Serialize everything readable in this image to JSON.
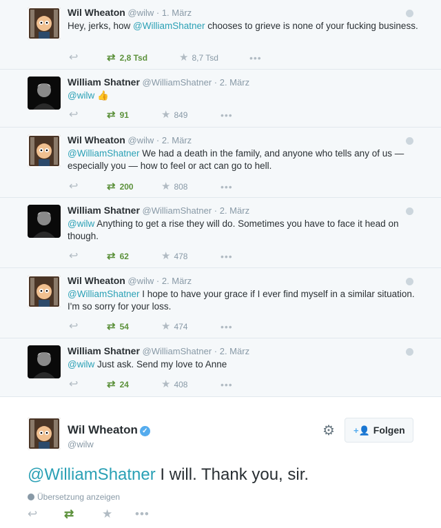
{
  "tweets": [
    {
      "fullname": "Wil Wheaton",
      "username": "@wilw",
      "time": "· 1. März",
      "text_pre": "Hey, jerks, how ",
      "mention": "@WilliamShatner",
      "text_post": "  chooses to grieve is none of your fucking business.",
      "retweets": "2,8 Tsd",
      "favorites": "8,7 Tsd",
      "avatar": "wil"
    },
    {
      "fullname": "William Shatner",
      "username": "@WilliamShatner",
      "time": "· 2. März",
      "text_pre": "",
      "mention": "@wilw",
      "text_post": " 👍",
      "retweets": "91",
      "favorites": "849",
      "avatar": "bill"
    },
    {
      "fullname": "Wil Wheaton",
      "username": "@wilw",
      "time": "· 2. März",
      "text_pre": "",
      "mention": "@WilliamShatner",
      "text_post": " We had a death in the family, and anyone who tells any of us — especially you — how to feel or act can go to hell.",
      "retweets": "200",
      "favorites": "808",
      "avatar": "wil"
    },
    {
      "fullname": "William Shatner",
      "username": "@WilliamShatner",
      "time": "· 2. März",
      "text_pre": "",
      "mention": "@wilw",
      "text_post": " Anything to get a rise they will do. Sometimes you have to face it head on though.",
      "retweets": "62",
      "favorites": "478",
      "avatar": "bill"
    },
    {
      "fullname": "Wil Wheaton",
      "username": "@wilw",
      "time": "· 2. März",
      "text_pre": "",
      "mention": "@WilliamShatner",
      "text_post": " I hope to have your grace if I ever find myself in a similar situation. I'm so sorry for your loss.",
      "retweets": "54",
      "favorites": "474",
      "avatar": "wil"
    },
    {
      "fullname": "William Shatner",
      "username": "@WilliamShatner",
      "time": "· 2. März",
      "text_pre": "",
      "mention": "@wilw",
      "text_post": " Just ask. Send my love to Anne",
      "retweets": "24",
      "favorites": "408",
      "avatar": "bill"
    }
  ],
  "main_tweet": {
    "fullname": "Wil Wheaton",
    "username": "@wilw",
    "follow_label": "Folgen",
    "mention": "@WilliamShatner",
    "text_post": " I will. Thank you, sir.",
    "translate_label": "Übersetzung anzeigen"
  },
  "icons": {
    "reply": "reply-icon",
    "retweet": "retweet-icon",
    "favorite": "star-icon",
    "more": "more-icon",
    "globe": "globe-icon",
    "gear": "gear-icon",
    "follow": "add-user-icon",
    "verified": "verified-icon"
  },
  "colors": {
    "mention": "#2aa0b5",
    "retweet": "#5c913b",
    "verified": "#55acee"
  }
}
